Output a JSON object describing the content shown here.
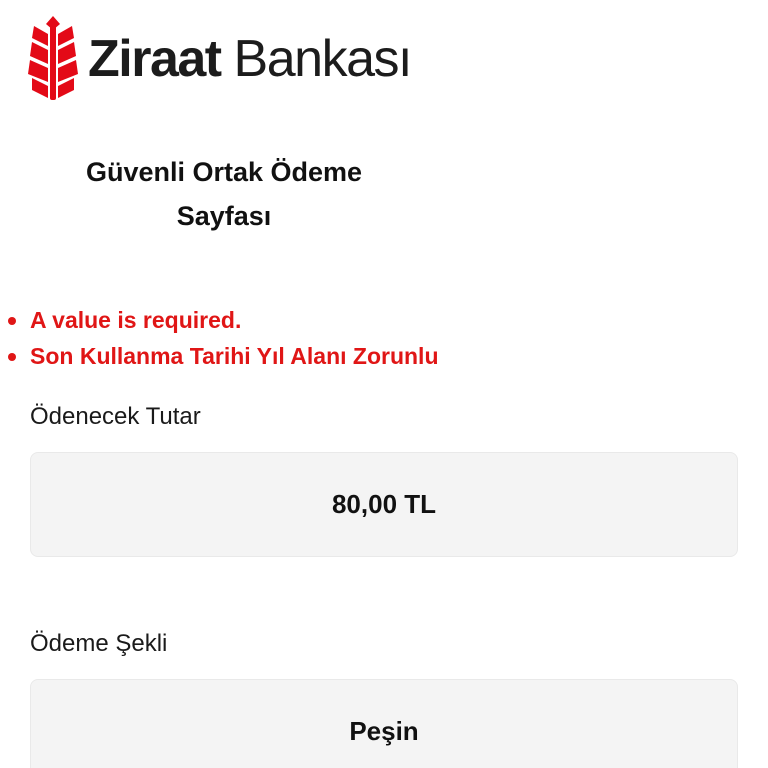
{
  "brand": {
    "name_bold": "Ziraat",
    "name_light": " Bankası",
    "color": "#e30a17"
  },
  "page": {
    "title_line1": "Güvenli Ortak Ödeme",
    "title_line2": "Sayfası"
  },
  "errors": [
    "A value is required.",
    "Son Kullanma Tarihi Yıl Alanı Zorunlu"
  ],
  "error_color": "#e01616",
  "fields": {
    "amount": {
      "label": "Ödenecek Tutar",
      "value": "80,00 TL"
    },
    "payment_method": {
      "label": "Ödeme Şekli",
      "value": "Peşin"
    }
  }
}
